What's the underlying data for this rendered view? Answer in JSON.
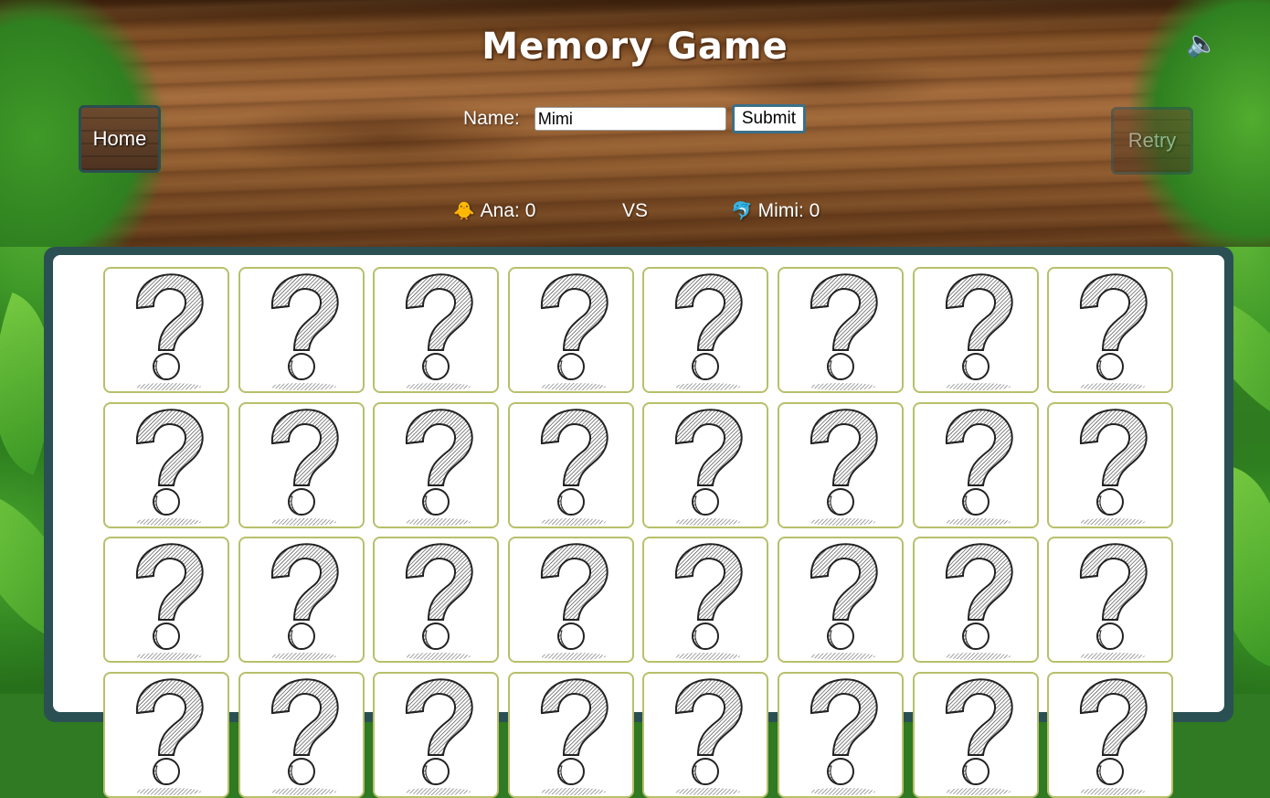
{
  "header": {
    "title": "Memory Game",
    "sound_icon": "speaker-icon",
    "home_label": "Home",
    "retry_label": "Retry"
  },
  "name_form": {
    "label": "Name:",
    "value": "Mimi",
    "submit_label": "Submit"
  },
  "scoreboard": {
    "player1": {
      "icon": "duck-icon",
      "emoji": "🐥",
      "text": "Ana: 0"
    },
    "vs": "VS",
    "player2": {
      "icon": "dolphin-icon",
      "emoji": "🐬",
      "text": "Mimi: 0"
    }
  },
  "board": {
    "columns": 8,
    "visible_rows": 4,
    "card_state": "face-down",
    "card_icon": "question-mark-icon",
    "border_color": "#b8c06a"
  },
  "colors": {
    "board_frame": "#2a5054",
    "wood": "#8e5a2e",
    "jungle": "#3a8f26"
  }
}
